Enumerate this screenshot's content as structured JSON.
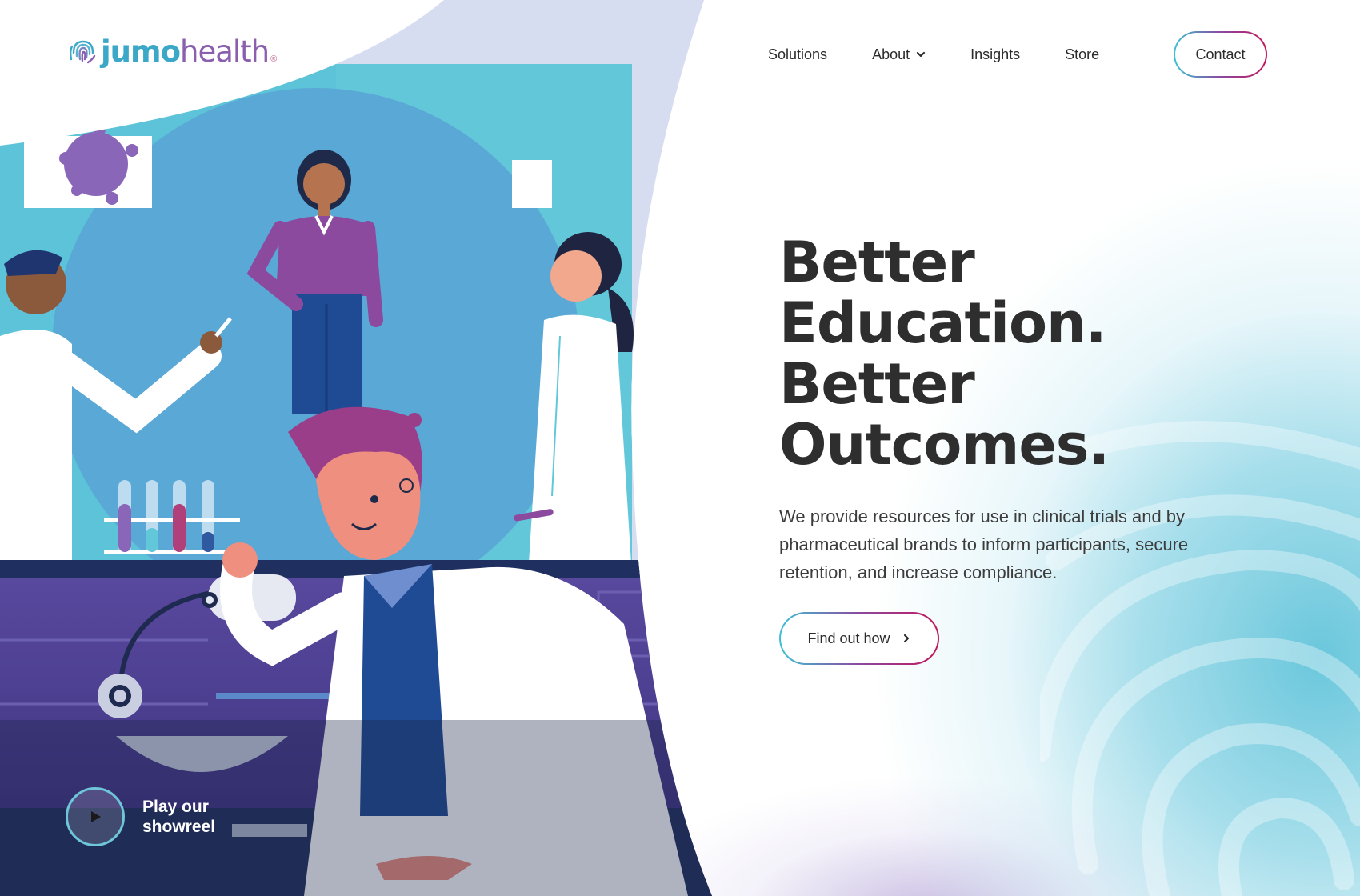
{
  "brand": {
    "name_part1": "jumo",
    "name_part2": "health",
    "registered": "®",
    "logo_icon": "fingerprint-icon",
    "colors": {
      "teal": "#3aa8c6",
      "purple": "#8a5fae",
      "magenta": "#c2185b"
    }
  },
  "nav": {
    "items": [
      {
        "label": "Solutions"
      },
      {
        "label": "About",
        "has_dropdown": true
      },
      {
        "label": "Insights"
      },
      {
        "label": "Store"
      }
    ],
    "contact_label": "Contact"
  },
  "hero": {
    "headline_1a": "Better",
    "headline_1b": "Education.",
    "headline_2a": "Better",
    "headline_2b": "Outcomes.",
    "description": "We provide resources for use in clinical trials and by pharmaceutical brands to inform participants, secure retention, and increase compliance.",
    "cta_label": "Find out how"
  },
  "showreel": {
    "line1": "Play our",
    "line2": "showreel"
  }
}
